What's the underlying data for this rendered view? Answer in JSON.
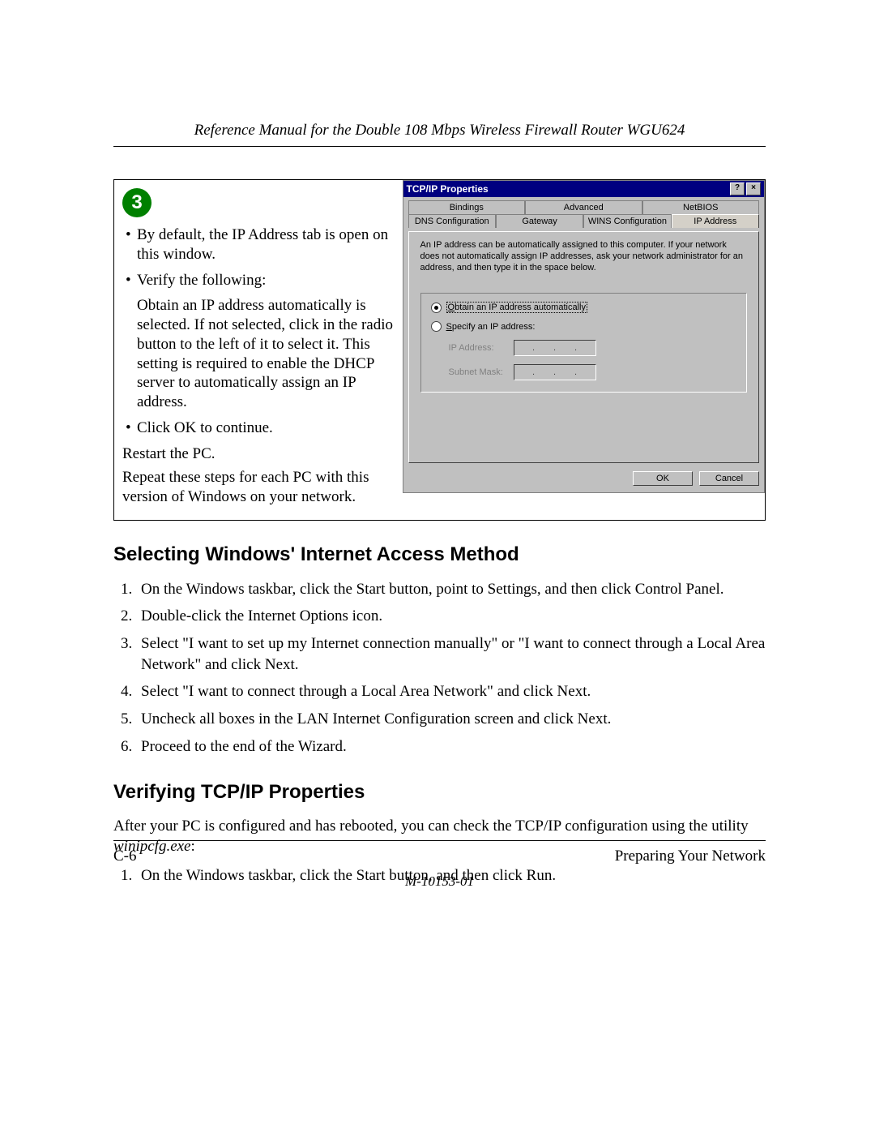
{
  "header": {
    "title": "Reference Manual for the Double 108 Mbps Wireless Firewall Router WGU624"
  },
  "step": {
    "number": "3",
    "bullet1": "By default, the IP Address tab is open on this window.",
    "bullet2": "Verify the following:",
    "sub1": "Obtain an IP address automatically is selected. If not selected, click in the radio button to the left of it to select it.  This setting is required to enable the DHCP server to automatically assign an IP address.",
    "bullet3": "Click OK to continue.",
    "para1": "Restart the PC.",
    "para2": "Repeat these steps for each PC with this version of Windows on your network."
  },
  "dialog": {
    "title": "TCP/IP Properties",
    "tabs_row1": {
      "t1": "Bindings",
      "t2": "Advanced",
      "t3": "NetBIOS"
    },
    "tabs_row2": {
      "t1": "DNS Configuration",
      "t2": "Gateway",
      "t3": "WINS Configuration",
      "t4": "IP Address"
    },
    "desc": "An IP address can be automatically assigned to this computer. If your network does not automatically assign IP addresses, ask your network administrator for an address, and then type it in the space below.",
    "radio_auto_pre": "O",
    "radio_auto_rest": "btain an IP address automatically",
    "radio_spec_pre": "S",
    "radio_spec_rest": "pecify an IP address:",
    "ip_label": "IP Address:",
    "mask_label": "Subnet Mask:",
    "ok": "OK",
    "cancel": "Cancel"
  },
  "section1": {
    "heading": "Selecting Windows' Internet Access Method",
    "steps": {
      "s1": "On the Windows taskbar, click the Start button, point to Settings, and then click Control Panel.",
      "s2": "Double-click the Internet Options icon.",
      "s3": "Select \"I want to set up my Internet connection manually\" or \"I want to connect through a Local Area Network\" and click Next.",
      "s4": "Select \"I want to connect through a Local Area Network\" and click Next.",
      "s5": "Uncheck all boxes in the LAN Internet Configuration screen and click Next.",
      "s6": "Proceed to the end of the Wizard."
    }
  },
  "section2": {
    "heading": "Verifying TCP/IP Properties",
    "intro_a": "After your PC is configured and has rebooted, you can check the TCP/IP configuration using the utility ",
    "intro_ital": "winipcfg.exe",
    "intro_b": ":",
    "steps": {
      "s1": "On the Windows taskbar, click the Start button, and then click Run."
    }
  },
  "footer": {
    "page": "C-6",
    "section": "Preparing Your Network",
    "docid": "M-10153-01"
  }
}
